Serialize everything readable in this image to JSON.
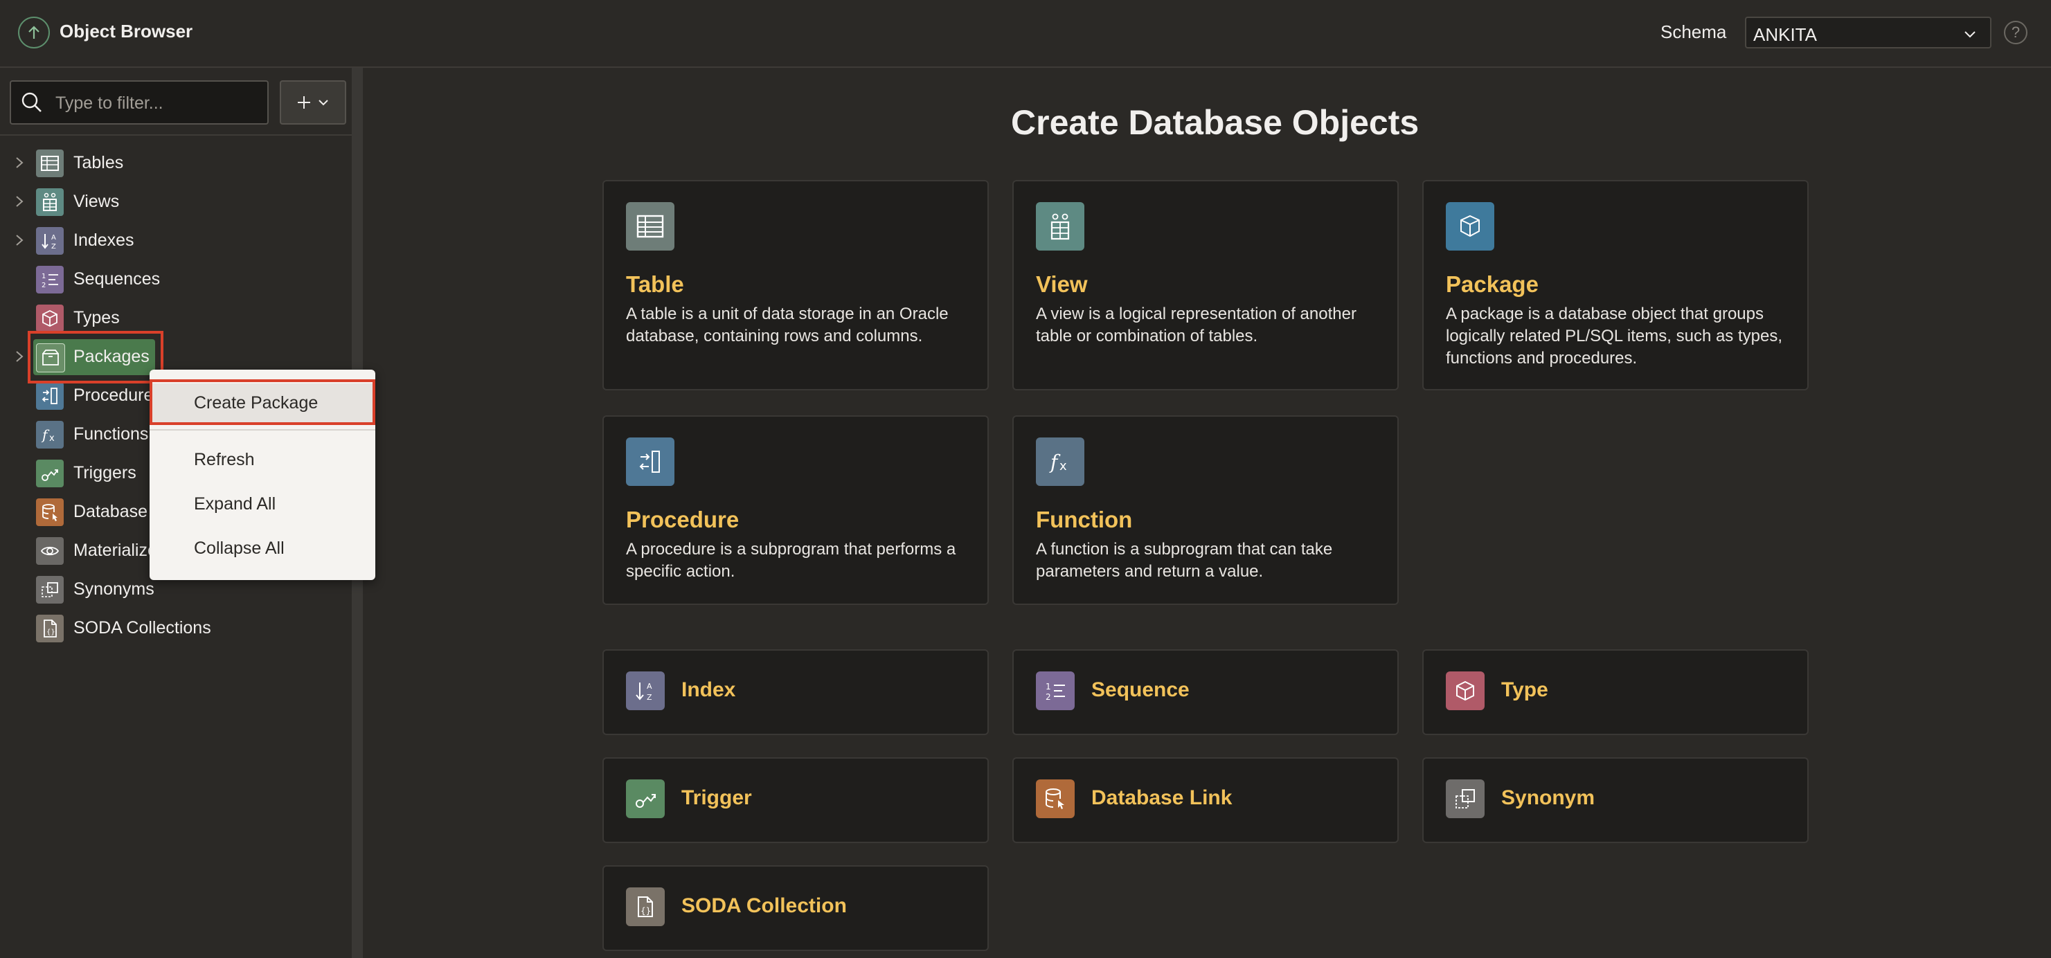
{
  "header": {
    "title": "Object Browser",
    "schema_label": "Schema",
    "schema_value": "ANKITA",
    "help": "?"
  },
  "sidebar": {
    "filter_placeholder": "Type to filter...",
    "items": [
      {
        "label": "Tables",
        "expandable": true,
        "color": "#6e7d78"
      },
      {
        "label": "Views",
        "expandable": true,
        "color": "#5e8a83"
      },
      {
        "label": "Indexes",
        "expandable": true,
        "color": "#6c6e8c"
      },
      {
        "label": "Sequences",
        "expandable": false,
        "color": "#7c6a96"
      },
      {
        "label": "Types",
        "expandable": false,
        "color": "#b05a68"
      },
      {
        "label": "Packages",
        "expandable": true,
        "color": "#4a7a4c"
      },
      {
        "label": "Procedures",
        "expandable": false,
        "color": "#4f7896"
      },
      {
        "label": "Functions",
        "expandable": false,
        "color": "#5a7286"
      },
      {
        "label": "Triggers",
        "expandable": false,
        "color": "#5a8a62"
      },
      {
        "label": "Database Links",
        "expandable": false,
        "color": "#b06a3a"
      },
      {
        "label": "Materialized Views",
        "expandable": false,
        "color": "#6a6865"
      },
      {
        "label": "Synonyms",
        "expandable": false,
        "color": "#6e6c6a"
      },
      {
        "label": "SODA Collections",
        "expandable": false,
        "color": "#7a7268"
      }
    ]
  },
  "context_menu": {
    "items": [
      "Create Package",
      "Refresh",
      "Expand All",
      "Collapse All"
    ]
  },
  "main": {
    "title": "Create Database Objects",
    "cards": [
      {
        "title": "Table",
        "desc": "A table is a unit of data storage in an Oracle database, containing rows and columns.",
        "color": "#6e7d78"
      },
      {
        "title": "View",
        "desc": "A view is a logical representation of another table or combination of tables.",
        "color": "#5e8a83"
      },
      {
        "title": "Package",
        "desc": "A package is a database object that groups logically related PL/SQL items, such as types, functions and procedures.",
        "color": "#3f7a9c"
      },
      {
        "title": "Procedure",
        "desc": "A procedure is a subprogram that performs a specific action.",
        "color": "#4f7896"
      },
      {
        "title": "Function",
        "desc": "A function is a subprogram that can take parameters and return a value.",
        "color": "#5a7286"
      }
    ],
    "small_cards": [
      {
        "title": "Index",
        "color": "#6c6e8c"
      },
      {
        "title": "Sequence",
        "color": "#7c6a96"
      },
      {
        "title": "Type",
        "color": "#b05a68"
      },
      {
        "title": "Trigger",
        "color": "#5a8a62"
      },
      {
        "title": "Database Link",
        "color": "#b06a3a"
      },
      {
        "title": "Synonym",
        "color": "#6e6c6a"
      },
      {
        "title": "SODA Collection",
        "color": "#7a7268"
      }
    ]
  }
}
